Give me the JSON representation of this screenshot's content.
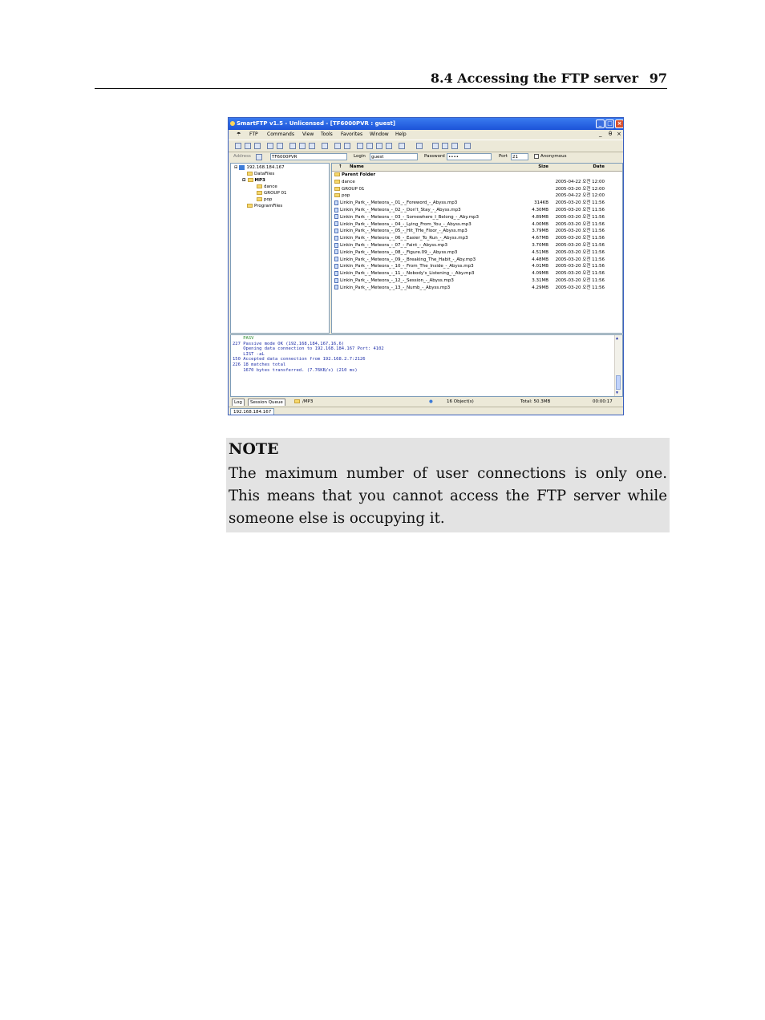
{
  "page": {
    "section": "8.4 Accessing the FTP server",
    "page_number": "97"
  },
  "window": {
    "title": "SmartFTP v1.5 - Unlicensed - [TF6000PVR : guest]",
    "menu": [
      "FTP",
      "Commands",
      "View",
      "Tools",
      "Favorites",
      "Window",
      "Help"
    ],
    "mdi_controls": [
      "_",
      "θ",
      "×"
    ],
    "address_label": "Address",
    "address_value": "TF6000PVR",
    "login_label": "Login",
    "login_value": "guest",
    "password_label": "Password",
    "password_value": "••••",
    "port_label": "Port",
    "port_value": "21",
    "anonymous_label": "Anonymous",
    "tree": {
      "root": "192.168.184.167",
      "items": [
        "DataFiles",
        "MP3",
        "dance",
        "GROUP 01",
        "pop",
        "ProgramFiles"
      ]
    },
    "list": {
      "headers": {
        "name": "Name",
        "size": "Size",
        "date": "Date"
      },
      "parent": "Parent Folder",
      "rows": [
        {
          "name": "dance",
          "size": "",
          "date": "2005-04-22 오전 12:00"
        },
        {
          "name": "GROUP 01",
          "size": "",
          "date": "2005-03-20 오전 12:00"
        },
        {
          "name": "pop",
          "size": "",
          "date": "2005-04-22 오전 12:00"
        },
        {
          "name": "Linkin_Park_-_Meteora_-_01_-_Foreword_-_Abyss.mp3",
          "size": "314KB",
          "date": "2005-03-20 오전 11:56"
        },
        {
          "name": "Linkin_Park_-_Meteora_-_02_-_Don't_Stay_-_Abyss.mp3",
          "size": "4.30MB",
          "date": "2005-03-20 오전 11:56"
        },
        {
          "name": "Linkin_Park_-_Meteora_-_03_-_Somewhere_I_Belong_-_Aby.mp3",
          "size": "4.89MB",
          "date": "2005-03-20 오전 11:56"
        },
        {
          "name": "Linkin_Park_-_Meteora_-_04_-_Lying_From_You_-_Abyss.mp3",
          "size": "4.00MB",
          "date": "2005-03-20 오전 11:56"
        },
        {
          "name": "Linkin_Park_-_Meteora_-_05_-_Hit_THe_Floor_-_Abyss.mp3",
          "size": "3.79MB",
          "date": "2005-03-20 오전 11:56"
        },
        {
          "name": "Linkin_Park_-_Meteora_-_06_-_Easier_To_Run_-_Abyss.mp3",
          "size": "4.67MB",
          "date": "2005-03-20 오전 11:56"
        },
        {
          "name": "Linkin_Park_-_Meteora_-_07_-_Faint_-_Abyss.mp3",
          "size": "3.70MB",
          "date": "2005-03-20 오전 11:56"
        },
        {
          "name": "Linkin_Park_-_Meteora_-_08_-_Figure.09_-_Abyss.mp3",
          "size": "4.51MB",
          "date": "2005-03-20 오전 11:56"
        },
        {
          "name": "Linkin_Park_-_Meteora_-_09_-_Breaking_The_Habit_-_Aby.mp3",
          "size": "4.48MB",
          "date": "2005-03-20 오전 11:56"
        },
        {
          "name": "Linkin_Park_-_Meteora_-_10_-_From_The_Inside_-_Abyss.mp3",
          "size": "4.01MB",
          "date": "2005-03-20 오전 11:56"
        },
        {
          "name": "Linkin_Park_-_Meteora_-_11_-_Nobody's_Listening_-_Aby.mp3",
          "size": "4.09MB",
          "date": "2005-03-20 오전 11:56"
        },
        {
          "name": "Linkin_Park_-_Meteora_-_12_-_Session_-_Abyss.mp3",
          "size": "3.31MB",
          "date": "2005-03-20 오전 11:56"
        },
        {
          "name": "Linkin_Park_-_Meteora_-_13_-_Numb_-_Abyss.mp3",
          "size": "4.29MB",
          "date": "2005-03-20 오전 11:56"
        }
      ]
    },
    "log": [
      "    PASV",
      "227 Passive mode OK (192,168,184,167,16,6)",
      "    Opening data connection to 192.168.184.167 Port: 4102",
      "    LIST -aL",
      "150 Accepted data connection from 192.168.2.7:2126",
      "226 18 matches total",
      "    1670 bytes transferred. (7.76KB/s) (210 ms)"
    ],
    "status": {
      "tab_log": "Log",
      "tab_queue": "Session Queue",
      "path": "/MP3",
      "objects": "16 Object(s)",
      "total": "Total: 50.3MB",
      "time": "00:00:17"
    },
    "connection_tab": "192.168.184.167"
  },
  "note": {
    "title": "NOTE",
    "body": "The maximum number of user connections is only one. This means that you cannot access the FTP server while someone else is occupying it."
  }
}
